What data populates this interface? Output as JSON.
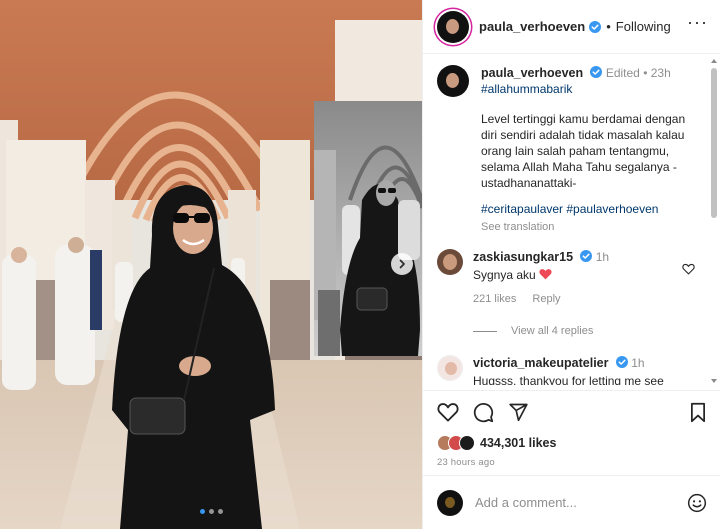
{
  "post": {
    "username": "paula_verhoeven",
    "follow_status": "Following",
    "carousel": {
      "current_index": 1,
      "total": 3
    }
  },
  "caption": {
    "username": "paula_verhoeven",
    "edited": "Edited",
    "time": "23h",
    "first_line": "#allahummabarik",
    "text": "Level tertinggi kamu berdamai dengan\ndiri sendiri adalah tidak masalah kalau\norang lain salah paham tentangmu,\nselama Allah Maha Tahu segalanya -\nustadhananattaki-",
    "hashtags": "#ceritapaulaver #paulaverhoeven",
    "see_translation": "See translation"
  },
  "comments": [
    {
      "username": "zaskiasungkar15",
      "time": "1h",
      "text": "Sygnya aku",
      "likes": "221 likes",
      "reply": "Reply",
      "view_replies": "View all 4 replies"
    },
    {
      "username": "victoria_makeupatelier",
      "time": "1h",
      "text": "Hugsss, thankyou for letting me see"
    }
  ],
  "engagement": {
    "likes": "434,301 likes",
    "timestamp": "23 hours ago"
  },
  "composer": {
    "placeholder": "Add a comment..."
  },
  "colors": {
    "verified": "#3897f0",
    "hashtag": "#00376b",
    "heart_red": "#ed4956"
  },
  "icons": {
    "verified": "verified-badge-icon",
    "more": "more-options-icon",
    "like": "heart-icon",
    "comment": "comment-bubble-icon",
    "share": "paper-plane-icon",
    "save": "bookmark-icon",
    "emoji": "emoji-smile-icon",
    "next": "chevron-right-icon"
  }
}
